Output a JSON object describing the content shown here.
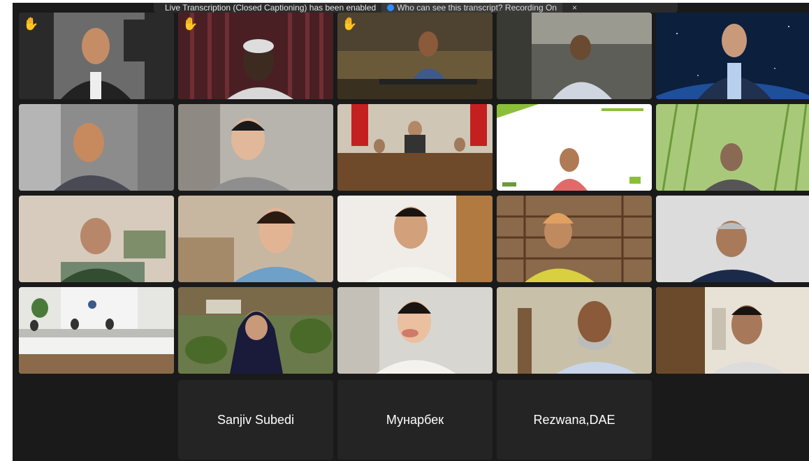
{
  "banner": {
    "text": "Live Transcription (Closed Captioning) has been enabled",
    "who_link": "Who can see this transcript? Recording On",
    "close": "×"
  },
  "tiles": [
    {
      "id": "t1",
      "hand": true
    },
    {
      "id": "t2",
      "hand": true,
      "active": true
    },
    {
      "id": "t3",
      "hand": true
    },
    {
      "id": "t4"
    },
    {
      "id": "t5"
    },
    {
      "id": "t6"
    },
    {
      "id": "t7"
    },
    {
      "id": "t8"
    },
    {
      "id": "t9"
    },
    {
      "id": "t10"
    },
    {
      "id": "t11"
    },
    {
      "id": "t12"
    },
    {
      "id": "t13"
    },
    {
      "id": "t14"
    },
    {
      "id": "t15"
    },
    {
      "id": "t16"
    },
    {
      "id": "t17"
    },
    {
      "id": "t18"
    },
    {
      "id": "t19"
    },
    {
      "id": "t20"
    }
  ],
  "name_tiles": [
    {
      "name": "Sanjiv Subedi"
    },
    {
      "name": "Мунарбек"
    },
    {
      "name": "Rezwana,DAE"
    }
  ],
  "icons": {
    "raised_hand": "raised-hand-icon",
    "close": "close-icon",
    "people": "people-icon"
  },
  "colors": {
    "active_speaker": "#22c55e",
    "hand": "#f5c542",
    "background": "#1a1a1a"
  }
}
